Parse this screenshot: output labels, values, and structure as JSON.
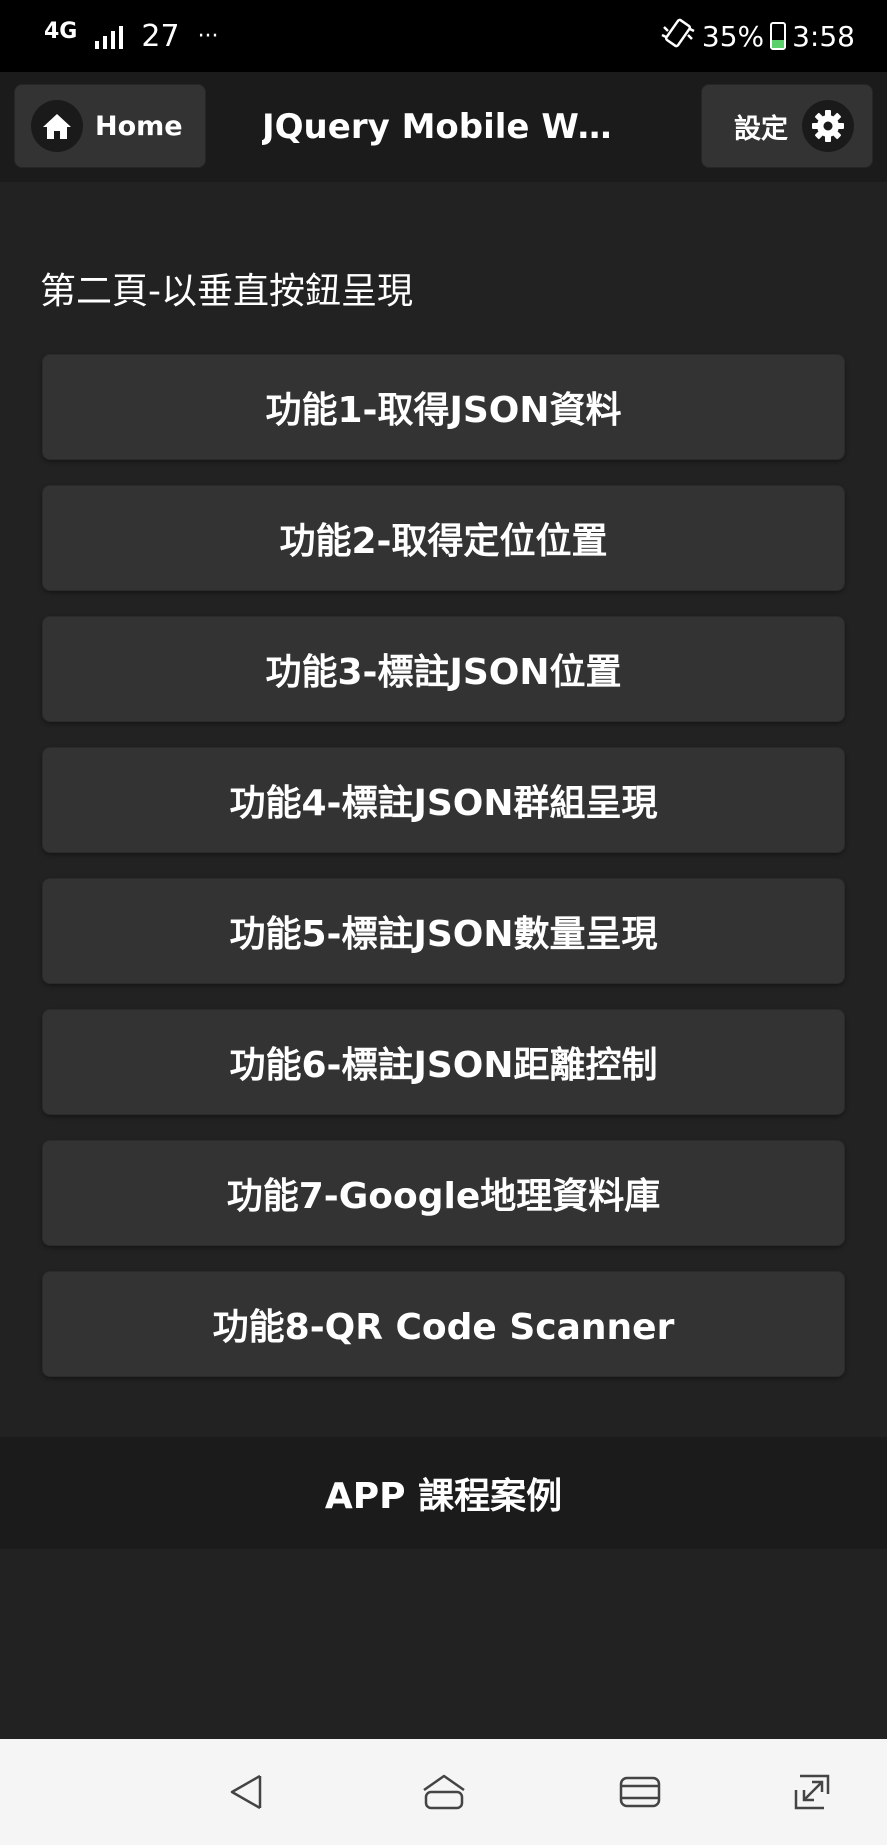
{
  "status_bar": {
    "network": "4G",
    "signal": "27",
    "more": "···",
    "battery": "35%",
    "time": "3:58",
    "battery_level": 0.35,
    "battery_color": "#5bd16b"
  },
  "header": {
    "home_label": "Home",
    "title": "JQuery Mobile We...",
    "settings_label": "設定"
  },
  "main": {
    "heading": "第二頁-以垂直按鈕呈現",
    "buttons": [
      "功能1-取得JSON資料",
      "功能2-取得定位位置",
      "功能3-標註JSON位置",
      "功能4-標註JSON群組呈現",
      "功能5-標註JSON數量呈現",
      "功能6-標註JSON距離控制",
      "功能7-Google地理資料庫",
      "功能8-QR Code Scanner"
    ]
  },
  "footer": {
    "title": "APP 課程案例"
  },
  "nav_bar": {
    "icons": [
      "back-icon",
      "home-icon",
      "recents-icon",
      "expand-icon"
    ]
  },
  "colors": {
    "page_bg": "#222222",
    "header_bg": "#1b1b1b",
    "button_bg": "#333333",
    "text": "#ffffff"
  }
}
